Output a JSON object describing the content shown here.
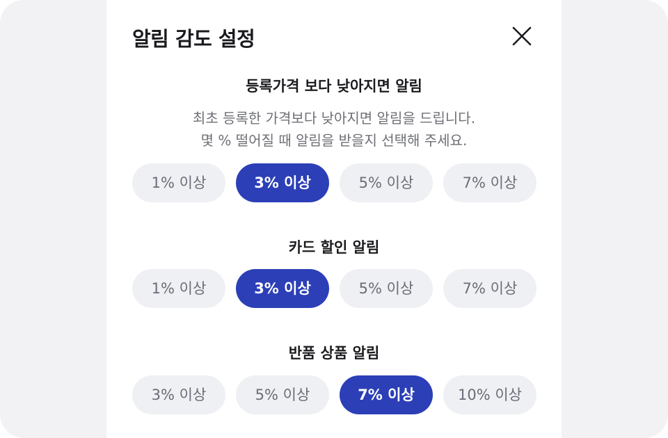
{
  "header": {
    "title": "알림 감도 설정",
    "close_icon": "close-icon"
  },
  "sections": [
    {
      "title": "등록가격 보다 낮아지면 알림",
      "description_lines": [
        "최초 등록한 가격보다 낮아지면 알림을 드립니다.",
        "몇 % 떨어질 때 알림을 받을지 선택해 주세요."
      ],
      "options": [
        "1% 이상",
        "3% 이상",
        "5% 이상",
        "7% 이상"
      ],
      "selected": "3% 이상"
    },
    {
      "title": "카드 할인 알림",
      "options": [
        "1% 이상",
        "3% 이상",
        "5% 이상",
        "7% 이상"
      ],
      "selected": "3% 이상"
    },
    {
      "title": "반품 상품 알림",
      "options": [
        "3% 이상",
        "5% 이상",
        "7% 이상",
        "10% 이상"
      ],
      "selected": "7% 이상"
    }
  ],
  "colors": {
    "accent": "#2c3fb7",
    "chip_bg": "#eff0f3",
    "chip_text": "#6a6d78",
    "backdrop": "#f2f2f4",
    "title_text": "#1b1b1f",
    "desc_text": "#6e6f76"
  }
}
